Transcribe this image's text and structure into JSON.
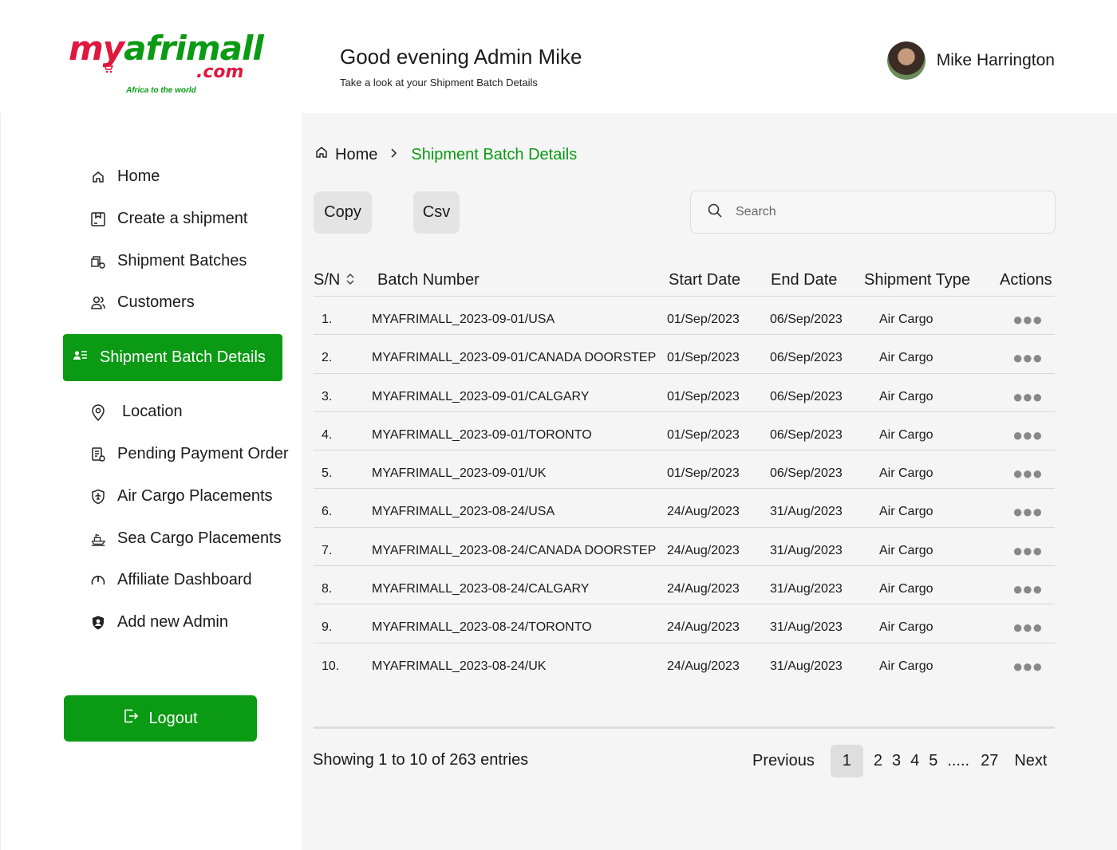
{
  "brand": {
    "logo_my": "my",
    "logo_afrimall": "afrimall",
    "logo_com": ".com",
    "tagline": "Africa to the world",
    "green": "#0a9a14",
    "red": "#e0173f"
  },
  "header": {
    "greeting": "Good evening Admin Mike",
    "subtitle": "Take a look at your Shipment Batch Details",
    "user_name": "Mike Harrington"
  },
  "sidebar": {
    "items": [
      {
        "label": "Home",
        "icon": "home-icon"
      },
      {
        "label": "Create a shipment",
        "icon": "package-icon"
      },
      {
        "label": "Shipment Batches",
        "icon": "batches-icon"
      },
      {
        "label": "Customers",
        "icon": "users-icon"
      },
      {
        "label": "Shipment Batch Details",
        "icon": "list-user-icon",
        "active": true
      },
      {
        "label": "Location",
        "icon": "map-pin-icon"
      },
      {
        "label": "Pending Payment Order",
        "icon": "receipt-icon"
      },
      {
        "label": "Air Cargo Placements",
        "icon": "shield-plane-icon"
      },
      {
        "label": "Sea Cargo Placements",
        "icon": "ship-icon"
      },
      {
        "label": "Affiliate Dashboard",
        "icon": "gauge-icon"
      },
      {
        "label": "Add new Admin",
        "icon": "admin-shield-icon"
      }
    ],
    "logout_label": "Logout"
  },
  "breadcrumb": {
    "home": "Home",
    "current": "Shipment Batch Details"
  },
  "toolbar": {
    "copy_label": "Copy",
    "csv_label": "Csv",
    "search_placeholder": "Search"
  },
  "table": {
    "headers": {
      "sn": "S/N",
      "batch_number": "Batch Number",
      "start_date": "Start Date",
      "end_date": "End Date",
      "shipment_type": "Shipment Type",
      "actions": "Actions"
    },
    "actions_glyph": "●●●",
    "rows": [
      {
        "sn": "1.",
        "batch_number": "MYAFRIMALL_2023-09-01/USA",
        "start_date": "01/Sep/2023",
        "end_date": "06/Sep/2023",
        "shipment_type": "Air Cargo"
      },
      {
        "sn": "2.",
        "batch_number": "MYAFRIMALL_2023-09-01/CANADA DOORSTEP",
        "start_date": "01/Sep/2023",
        "end_date": "06/Sep/2023",
        "shipment_type": "Air Cargo"
      },
      {
        "sn": "3.",
        "batch_number": "MYAFRIMALL_2023-09-01/CALGARY",
        "start_date": "01/Sep/2023",
        "end_date": "06/Sep/2023",
        "shipment_type": "Air Cargo"
      },
      {
        "sn": "4.",
        "batch_number": "MYAFRIMALL_2023-09-01/TORONTO",
        "start_date": "01/Sep/2023",
        "end_date": "06/Sep/2023",
        "shipment_type": "Air Cargo"
      },
      {
        "sn": "5.",
        "batch_number": "MYAFRIMALL_2023-09-01/UK",
        "start_date": "01/Sep/2023",
        "end_date": "06/Sep/2023",
        "shipment_type": "Air Cargo"
      },
      {
        "sn": "6.",
        "batch_number": "MYAFRIMALL_2023-08-24/USA",
        "start_date": "24/Aug/2023",
        "end_date": "31/Aug/2023",
        "shipment_type": "Air Cargo"
      },
      {
        "sn": "7.",
        "batch_number": "MYAFRIMALL_2023-08-24/CANADA DOORSTEP",
        "start_date": "24/Aug/2023",
        "end_date": "31/Aug/2023",
        "shipment_type": "Air Cargo"
      },
      {
        "sn": "8.",
        "batch_number": "MYAFRIMALL_2023-08-24/CALGARY",
        "start_date": "24/Aug/2023",
        "end_date": "31/Aug/2023",
        "shipment_type": "Air Cargo"
      },
      {
        "sn": "9.",
        "batch_number": "MYAFRIMALL_2023-08-24/TORONTO",
        "start_date": "24/Aug/2023",
        "end_date": "31/Aug/2023",
        "shipment_type": "Air Cargo"
      },
      {
        "sn": "10.",
        "batch_number": "MYAFRIMALL_2023-08-24/UK",
        "start_date": "24/Aug/2023",
        "end_date": "31/Aug/2023",
        "shipment_type": "Air Cargo"
      }
    ]
  },
  "footer": {
    "entries_text": "Showing 1 to 10 of 263 entries",
    "pagination": {
      "previous": "Previous",
      "active": "1",
      "pages": [
        "2",
        "3",
        "4",
        "5"
      ],
      "ellipsis": ".....",
      "last": "27",
      "next": "Next"
    }
  }
}
